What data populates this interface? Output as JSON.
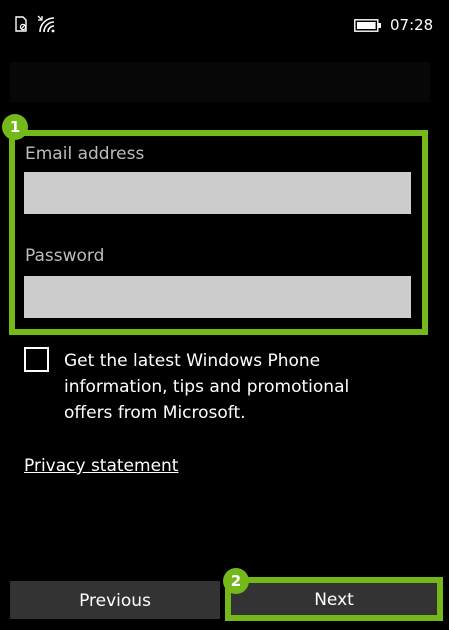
{
  "status_bar": {
    "time": "07:28",
    "icons": [
      "sim-icon",
      "wifi-icon",
      "battery-icon"
    ]
  },
  "form": {
    "email_label": "Email address",
    "email_value": "",
    "password_label": "Password",
    "password_value": "",
    "checkbox_label": "Get the latest Windows Phone information, tips and promotional offers from Microsoft.",
    "checkbox_checked": false,
    "privacy_link": "Privacy statement"
  },
  "buttons": {
    "previous": "Previous",
    "next": "Next"
  },
  "annotations": {
    "step_one": "1",
    "step_two": "2"
  },
  "colors": {
    "accent_highlight": "#74b81a",
    "input_background": "#cccccc",
    "button_background": "#333333",
    "page_background": "#000000"
  }
}
